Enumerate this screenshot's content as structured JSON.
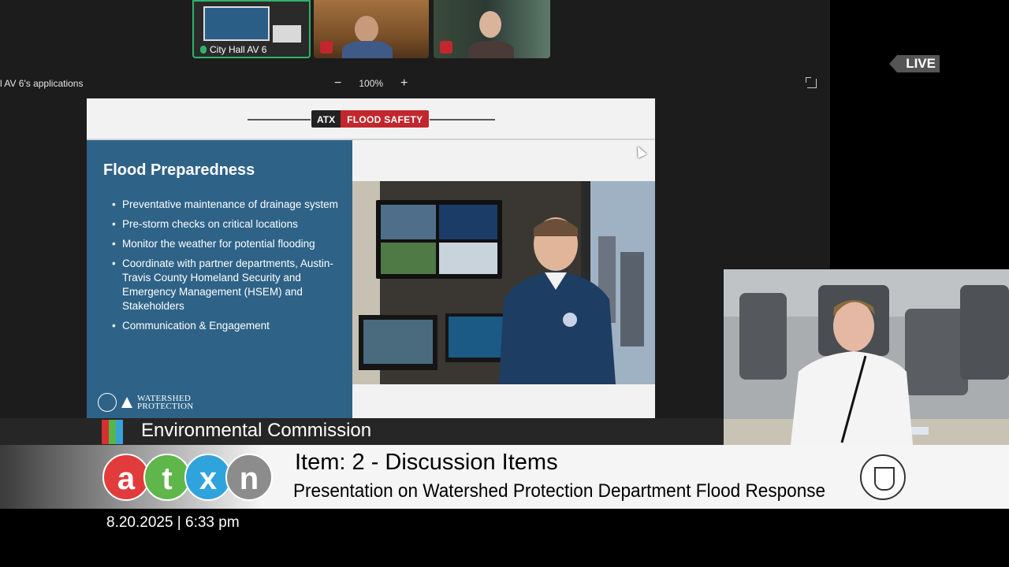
{
  "participants": [
    {
      "label": "City Hall AV 6",
      "active": true
    },
    {
      "label": "",
      "muted": true
    },
    {
      "label": "",
      "muted": true
    }
  ],
  "share": {
    "title": "l AV 6's applications",
    "zoom_minus": "−",
    "zoom_level": "100%",
    "zoom_plus": "+"
  },
  "slide": {
    "logo_atx": "ATX",
    "logo_flood": "FLOOD SAFETY",
    "title": "Flood Preparedness",
    "bullets": [
      "Preventative maintenance of drainage system",
      "Pre-storm checks on critical locations",
      "Monitor the weather for potential flooding",
      "Coordinate with partner departments, Austin-Travis County Homeland Security and Emergency Management (HSEM) and Stakeholders",
      "Communication & Engagement"
    ],
    "footer_logo_line1": "WATERSHED",
    "footer_logo_line2": "PROTECTION"
  },
  "live_badge": "LIVE",
  "lower_third": {
    "commission": "Environmental Commission",
    "stripe_colors": [
      "#d6312e",
      "#58b547",
      "#36a2d8"
    ],
    "logo_letters": [
      {
        "char": "a",
        "color": "#e23b3b"
      },
      {
        "char": "t",
        "color": "#5fb64a"
      },
      {
        "char": "x",
        "color": "#2fa3dc"
      },
      {
        "char": "n",
        "color": "#8c8c8c"
      }
    ],
    "item_title": "Item: 2 - Discussion Items",
    "item_subtitle": "Presentation on Watershed Protection Department Flood Response"
  },
  "timestamp": "8.20.2025 | 6:33 pm"
}
